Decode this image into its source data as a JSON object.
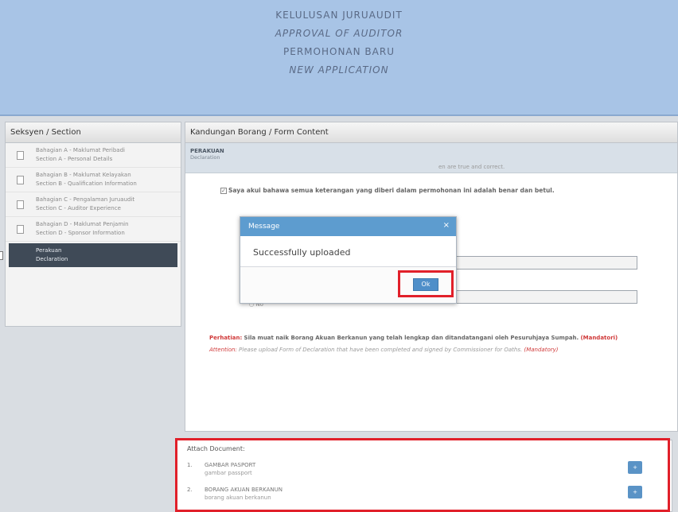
{
  "header": {
    "lines": [
      "KELULUSAN JURUAUDIT",
      "APPROVAL OF AUDITOR",
      "PERMOHONAN BARU",
      "NEW APPLICATION"
    ]
  },
  "left_panel": {
    "title": "Seksyen / Section",
    "items": [
      {
        "ms": "Bahagian A - Maklumat Peribadi",
        "en": "Section A - Personal Details",
        "active": false
      },
      {
        "ms": "Bahagian B - Maklumat Kelayakan",
        "en": "Section B - Qualification Information",
        "active": false
      },
      {
        "ms": "Bahagian C - Pengalaman Juruaudit",
        "en": "Section C - Auditor Experience",
        "active": false
      },
      {
        "ms": "Bahagian D - Maklumat Penjamin",
        "en": "Section D - Sponsor Information",
        "active": false
      },
      {
        "ms": "Perakuan",
        "en": "Declaration",
        "active": true
      }
    ]
  },
  "main": {
    "title": "Kandungan Borang / Form Content",
    "declaration_ms": "PERAKUAN",
    "declaration_en": "Declaration",
    "statement_ms": "Saya akui bahawa semua keterangan yang diberi dalam permohonan ini adalah benar dan betul.",
    "statement_en_tail": "en are true and correct.",
    "no_label": "No",
    "warning_label": "Perhatian:",
    "warning_ms": "Sila muat naik Borang Akuan Berkanun yang telah lengkap dan ditandatangani oleh Pesuruhjaya Sumpah.",
    "warning_ms_req": "(Mandatori)",
    "warning_en_label": "Attention:",
    "warning_en": "Please upload Form of Declaration that have been completed and signed by Commissioner for Oaths.",
    "warning_en_req": "(Mandatory)"
  },
  "attach": {
    "title": "Attach Document:",
    "items": [
      {
        "num": "1.",
        "label": "GAMBAR PASPORT",
        "sub": "gambar passport",
        "btn": "+"
      },
      {
        "num": "2.",
        "label": "BORANG AKUAN BERKANUN",
        "sub": "borang akuan berkanun",
        "btn": "+"
      }
    ]
  },
  "dialog": {
    "title": "Message",
    "close": "×",
    "message": "Successfully uploaded",
    "ok": "Ok"
  },
  "colors": {
    "header_bg": "#a8c4e6",
    "dialog_header": "#5d9ccf",
    "highlight": "#e1202a",
    "active_section": "#3f4a57"
  }
}
